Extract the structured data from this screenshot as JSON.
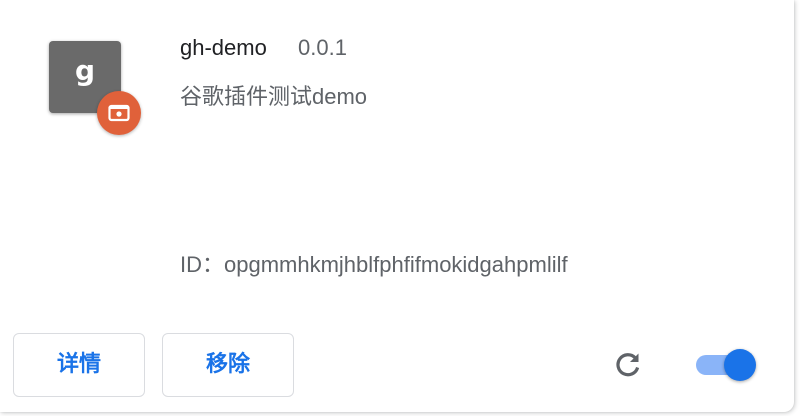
{
  "extension": {
    "icon_letter": "g",
    "badge_icon": "unpacked-extension-icon",
    "name": "gh-demo",
    "version": "0.0.1",
    "description": "谷歌插件测试demo",
    "id_text": "ID：opgmmhkmjhblfphfifmokidgahpmlilf"
  },
  "actions": {
    "details_label": "详情",
    "remove_label": "移除",
    "reload_icon": "reload-icon",
    "enabled": true
  },
  "colors": {
    "accent": "#1a73e8",
    "toggle_track": "#8ab4f8",
    "badge": "#e0613a",
    "icon_bg": "#6a6a6a"
  }
}
